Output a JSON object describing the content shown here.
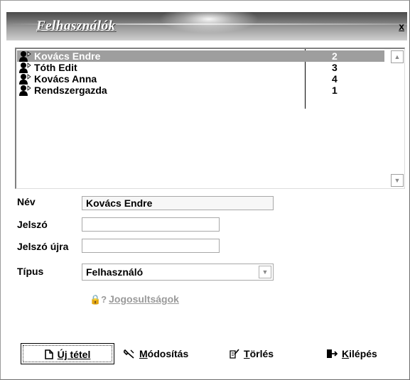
{
  "window": {
    "title": "Felhasználók",
    "close_label": "x"
  },
  "users": [
    {
      "name": "Kovács Endre",
      "number": "2",
      "selected": true
    },
    {
      "name": "Tóth Edit",
      "number": "3",
      "selected": false
    },
    {
      "name": "Kovács Anna",
      "number": "4",
      "selected": false
    },
    {
      "name": "Rendszergazda",
      "number": "1",
      "selected": false
    }
  ],
  "form": {
    "name_label": "Név",
    "name_value": "Kovács Endre",
    "password_label": "Jelszó",
    "password_value": "",
    "password_again_label": "Jelszó újra",
    "password_again_value": "",
    "type_label": "Típus",
    "type_value": "Felhasználó",
    "permissions_button": "Jogosultságok"
  },
  "buttons": {
    "new_item": "Új tétel",
    "modify": "Módosítás",
    "delete": "Törlés",
    "exit": "Kilépés"
  },
  "colors": {
    "selection": "#9e9e9e",
    "disabled_text": "#9a9a9a"
  }
}
